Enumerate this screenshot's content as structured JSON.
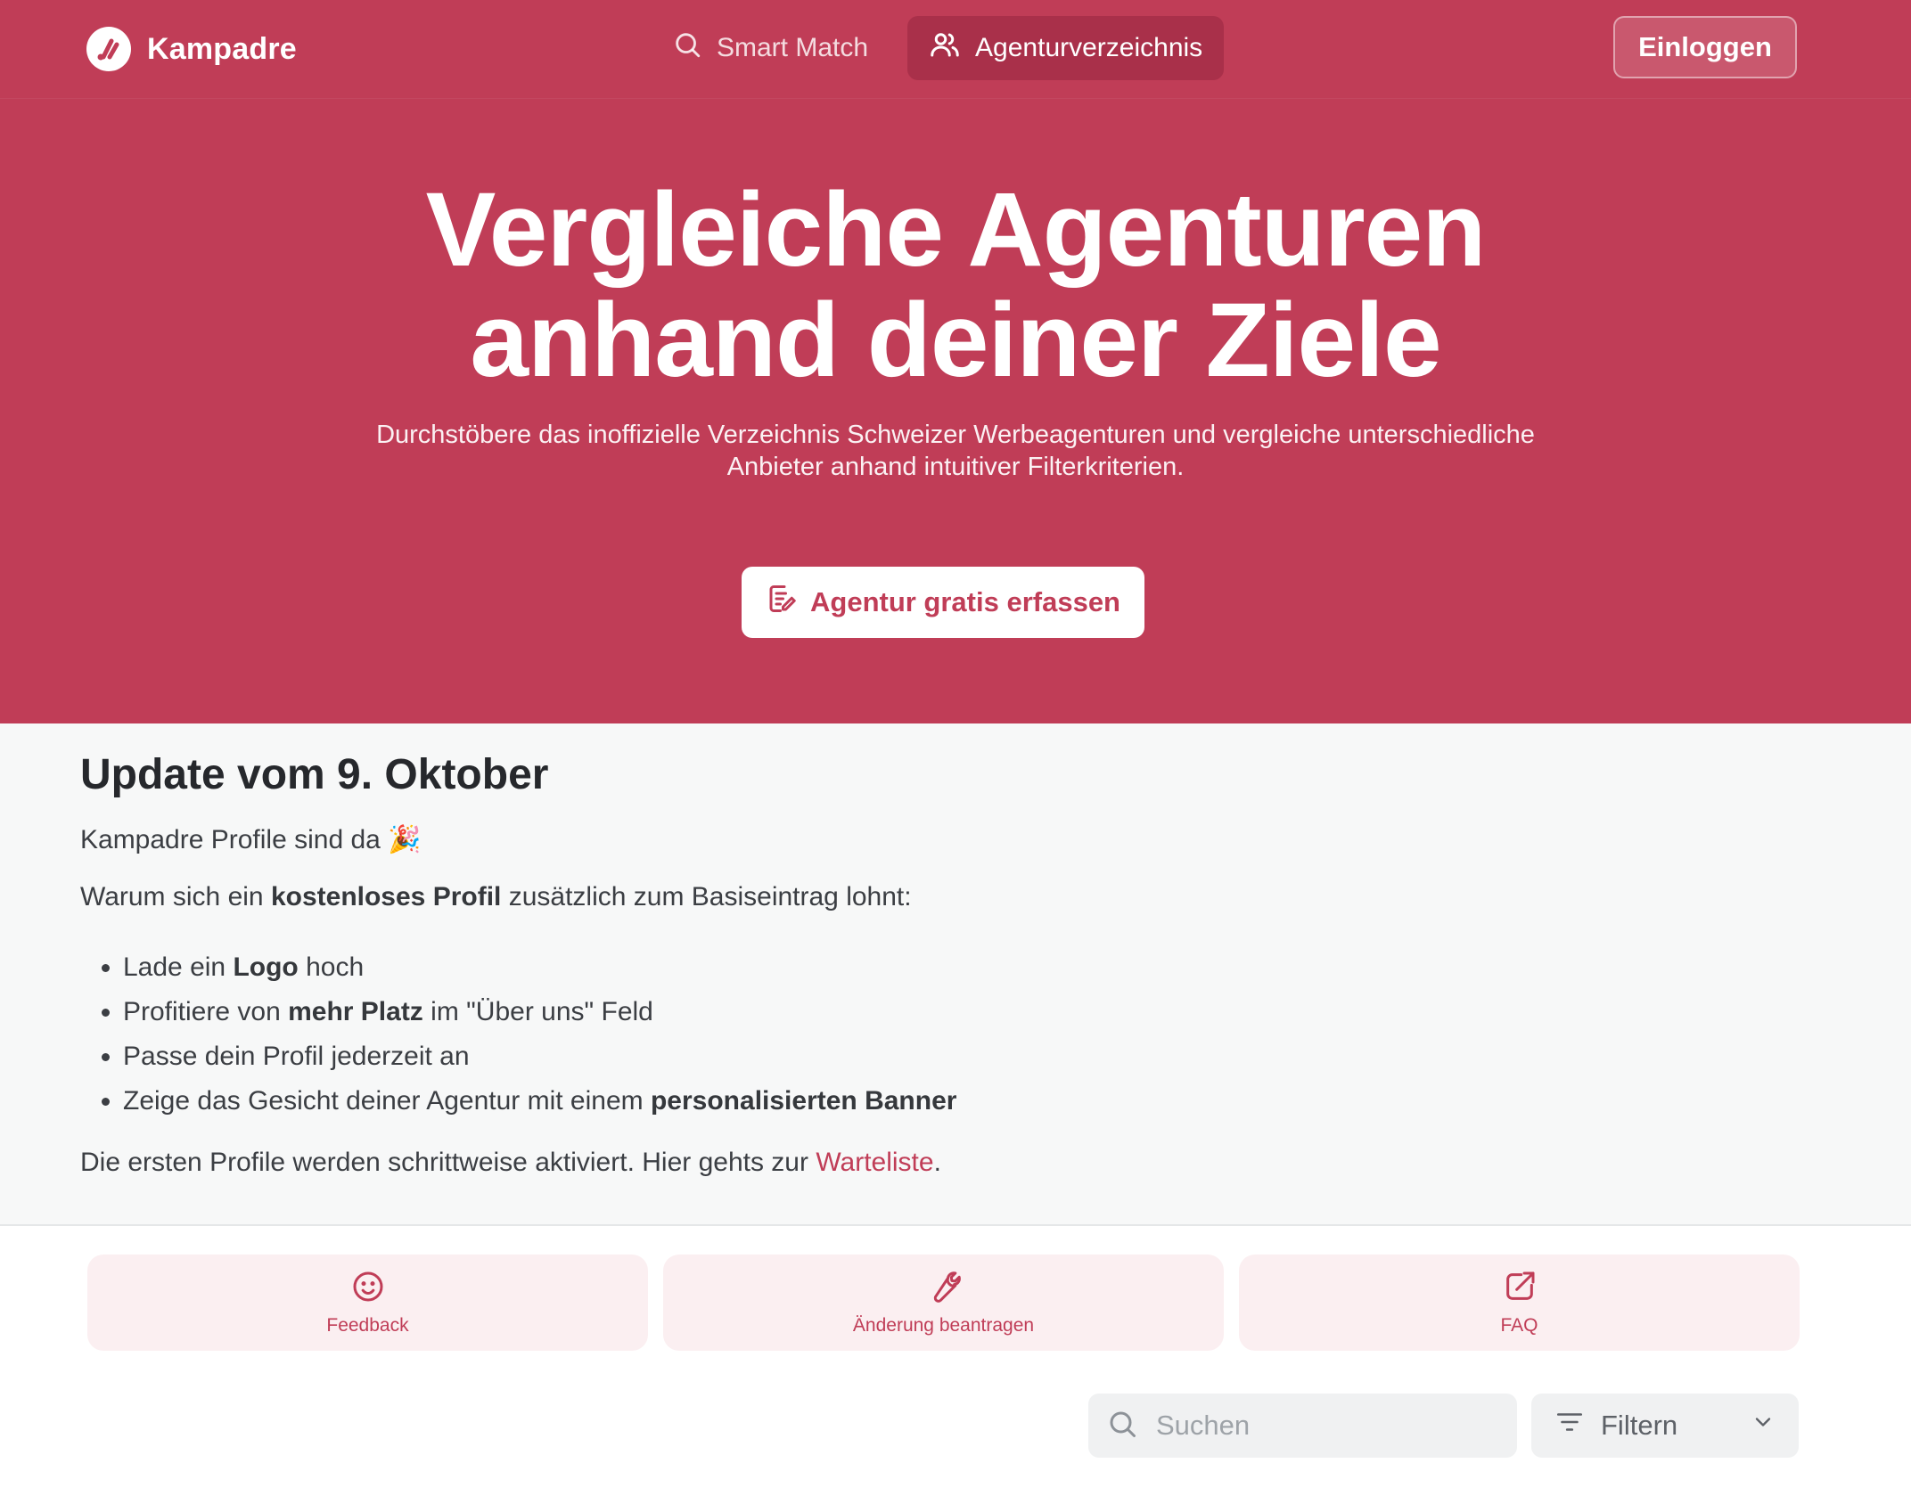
{
  "brand": {
    "name": "Kampadre",
    "accent": "#c03d57"
  },
  "nav": {
    "items": [
      {
        "label": "Smart Match",
        "icon": "search-icon",
        "active": false
      },
      {
        "label": "Agenturverzeichnis",
        "icon": "users-icon",
        "active": true
      }
    ],
    "login_label": "Einloggen"
  },
  "hero": {
    "title_line1": "Vergleiche Agenturen",
    "title_line2": "anhand deiner Ziele",
    "subtitle_line1": "Durchstöbere das inoffizielle Verzeichnis Schweizer Werbeagenturen und vergleiche unterschiedliche",
    "subtitle_line2": "Anbieter anhand intuitiver Filterkriterien.",
    "cta_label": "Agentur gratis erfassen"
  },
  "update": {
    "title": "Update vom 9. Oktober",
    "intro": "Kampadre Profile sind da 🎉",
    "why_prefix": "Warum sich ein ",
    "why_bold": "kostenloses Profil",
    "why_suffix": " zusätzlich zum Basiseintrag lohnt:",
    "list": [
      {
        "pre": "Lade ein ",
        "bold": "Logo",
        "post": " hoch"
      },
      {
        "pre": "Profitiere von ",
        "bold": "mehr Platz",
        "post": " im \"Über uns\" Feld"
      },
      {
        "pre": "Passe dein Profil jederzeit an",
        "bold": "",
        "post": ""
      },
      {
        "pre": "Zeige das Gesicht deiner Agentur mit einem ",
        "bold": "personalisierten Banner",
        "post": ""
      }
    ],
    "closing_prefix": "Die ersten Profile werden schrittweise aktiviert. Hier gehts zur ",
    "closing_link": "Warteliste",
    "closing_suffix": "."
  },
  "actions": [
    {
      "label": "Feedback",
      "icon": "smile-icon"
    },
    {
      "label": "Änderung beantragen",
      "icon": "wrench-icon"
    },
    {
      "label": "FAQ",
      "icon": "external-link-icon"
    }
  ],
  "search": {
    "placeholder": "Suchen"
  },
  "filter": {
    "label": "Filtern"
  }
}
